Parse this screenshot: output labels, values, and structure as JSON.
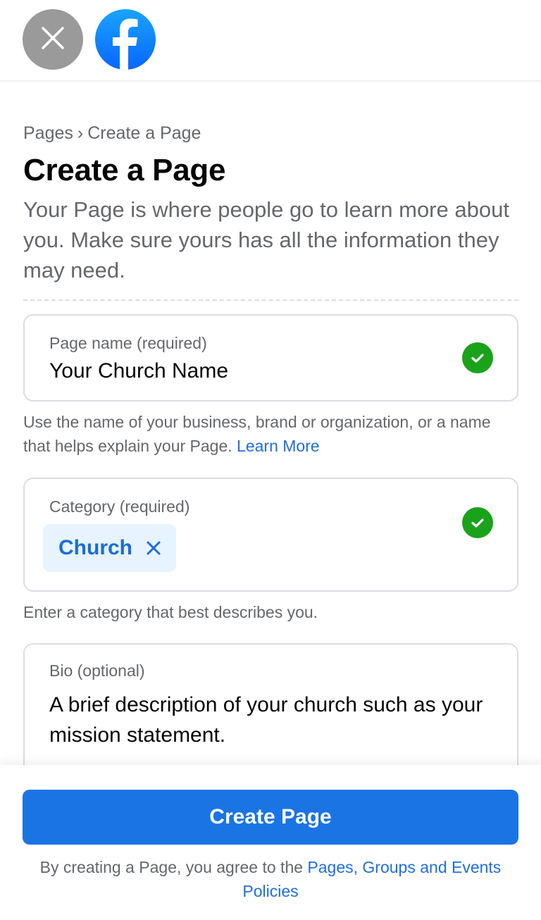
{
  "header": {
    "close_icon": "close-icon",
    "logo_icon": "facebook-logo-icon"
  },
  "breadcrumb": {
    "items": [
      "Pages",
      "Create a Page"
    ],
    "separator": "›"
  },
  "title": "Create a Page",
  "description": "Your Page is where people go to learn more about you. Make sure yours has all the information they may need.",
  "fields": {
    "page_name": {
      "label": "Page name (required)",
      "value": "Your Church Name",
      "status": "valid",
      "helper_text": "Use the name of your business, brand or organization, or a name that helps explain your Page.",
      "helper_link": "Learn More"
    },
    "category": {
      "label": "Category (required)",
      "chips": [
        "Church"
      ],
      "status": "valid",
      "helper_text": "Enter a category that best describes you."
    },
    "bio": {
      "label": "Bio (optional)",
      "value": "A brief description of your church such as your mission statement."
    }
  },
  "footer": {
    "button_label": "Create Page",
    "terms_text": "By creating a Page, you agree to the",
    "terms_link": "Pages, Groups and Events Policies"
  },
  "colors": {
    "primary": "#1b74e4",
    "link": "#216fdb",
    "success": "#1ba21b",
    "chip_bg": "#e7f3ff"
  }
}
